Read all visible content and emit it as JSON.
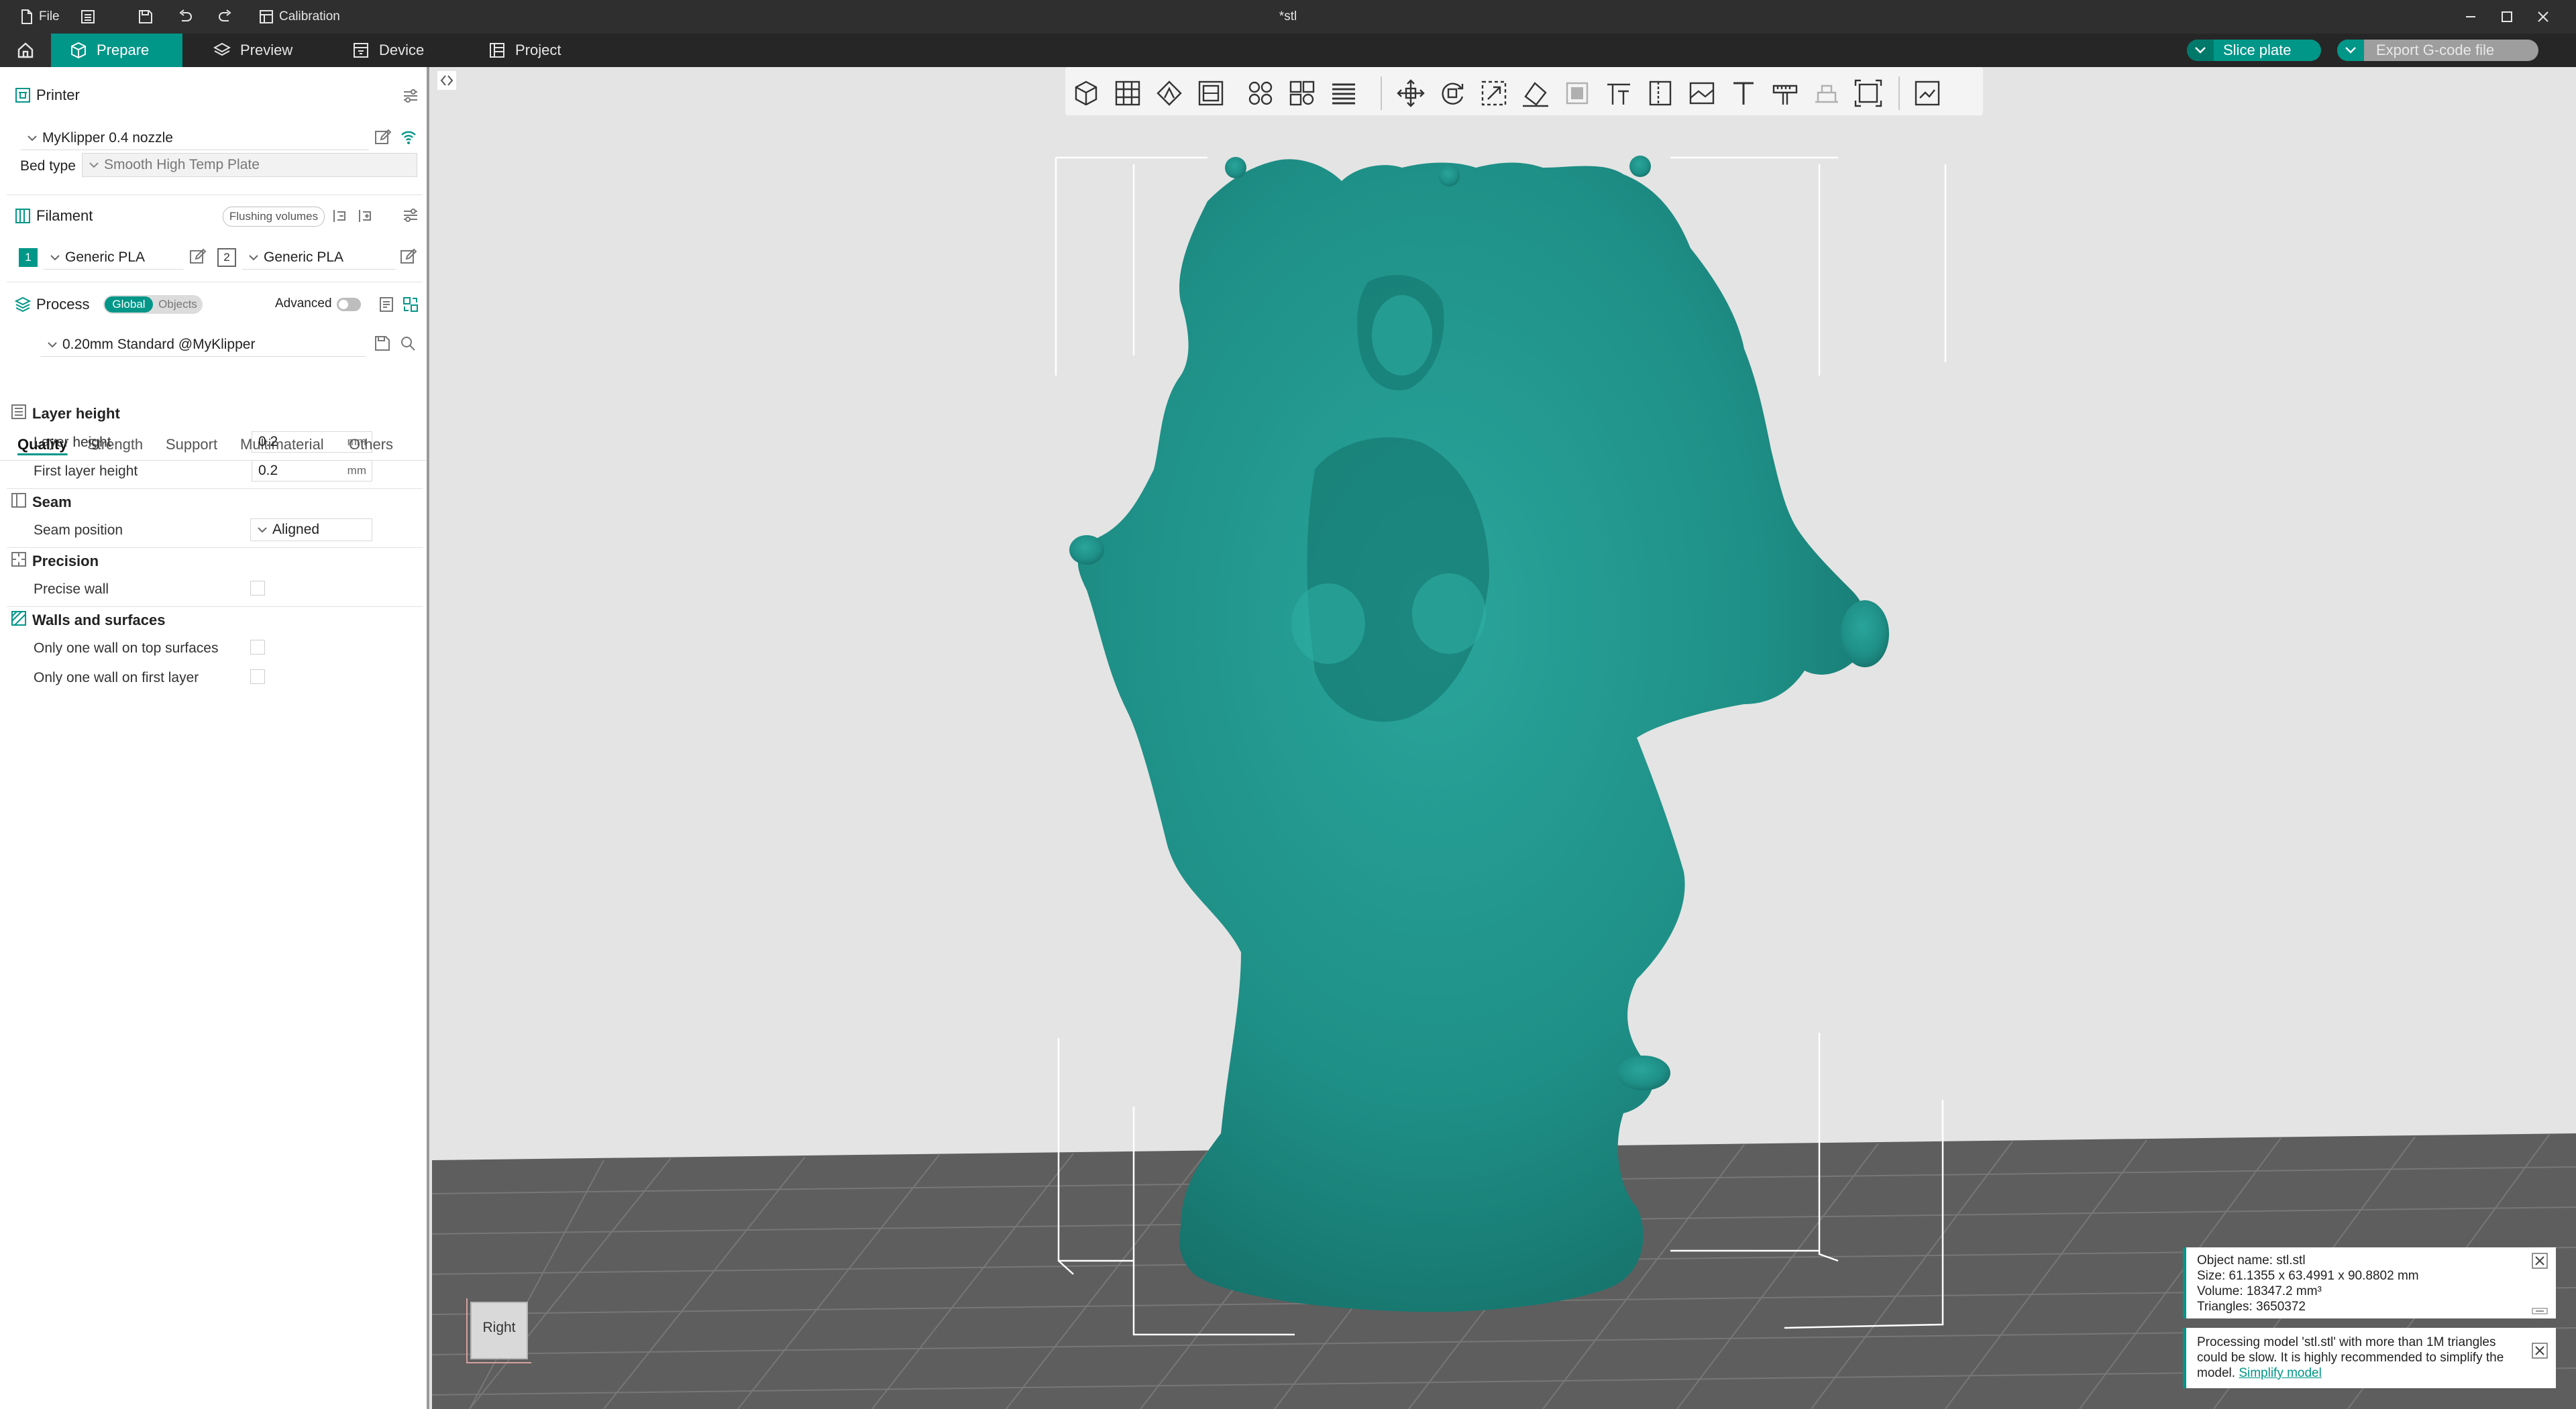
{
  "titlebar": {
    "file_label": "File",
    "calibration_label": "Calibration",
    "window_title": "*stl"
  },
  "tabs": [
    {
      "label": "Prepare",
      "icon": "cube-icon"
    },
    {
      "label": "Preview",
      "icon": "layers-icon"
    },
    {
      "label": "Device",
      "icon": "device-icon"
    },
    {
      "label": "Project",
      "icon": "project-icon"
    }
  ],
  "actions": {
    "slice_label": "Slice plate",
    "export_label": "Export G-code file"
  },
  "printer": {
    "section_title": "Printer",
    "selected": "MyKlipper 0.4 nozzle",
    "bed_type_label": "Bed type",
    "bed_type_value": "Smooth High Temp Plate"
  },
  "filament": {
    "section_title": "Filament",
    "flushing_label": "Flushing volumes",
    "slots": [
      {
        "index": "1",
        "name": "Generic PLA",
        "color": "#009688"
      },
      {
        "index": "2",
        "name": "Generic PLA",
        "color": "#ffffff"
      }
    ]
  },
  "process": {
    "section_title": "Process",
    "global_label": "Global",
    "objects_label": "Objects",
    "advanced_label": "Advanced",
    "preset": "0.20mm Standard @MyKlipper",
    "tabs": [
      "Quality",
      "Strength",
      "Support",
      "Multimaterial",
      "Others"
    ],
    "groups": {
      "layer_height": {
        "title": "Layer height",
        "layer_height_label": "Layer height",
        "layer_height_value": "0.2",
        "first_layer_label": "First layer height",
        "first_layer_value": "0.2",
        "unit": "mm"
      },
      "seam": {
        "title": "Seam",
        "position_label": "Seam position",
        "position_value": "Aligned"
      },
      "precision": {
        "title": "Precision",
        "precise_wall_label": "Precise wall"
      },
      "walls": {
        "title": "Walls and surfaces",
        "one_wall_top_label": "Only one wall on top surfaces",
        "one_wall_first_label": "Only one wall on first layer"
      }
    }
  },
  "viewcube": {
    "label": "Right"
  },
  "object_info": {
    "name_line": "Object name: stl.stl",
    "size_line": "Size: 61.1355 x 63.4991 x 90.8802 mm",
    "volume_line": "Volume: 18347.2 mm³",
    "triangles_line": "Triangles: 3650372"
  },
  "notification": {
    "text": "Processing model 'stl.stl' with more than 1M triangles could be slow. It is highly recommended to simplify the model.",
    "link": "Simplify model"
  },
  "colors": {
    "accent": "#009688",
    "model": "#1e8f86",
    "titlebar_bg": "#2f2f2f",
    "tabbar_bg": "#262626",
    "viewport_bg": "#e4e4e4",
    "floor": "#5e5e5e"
  }
}
